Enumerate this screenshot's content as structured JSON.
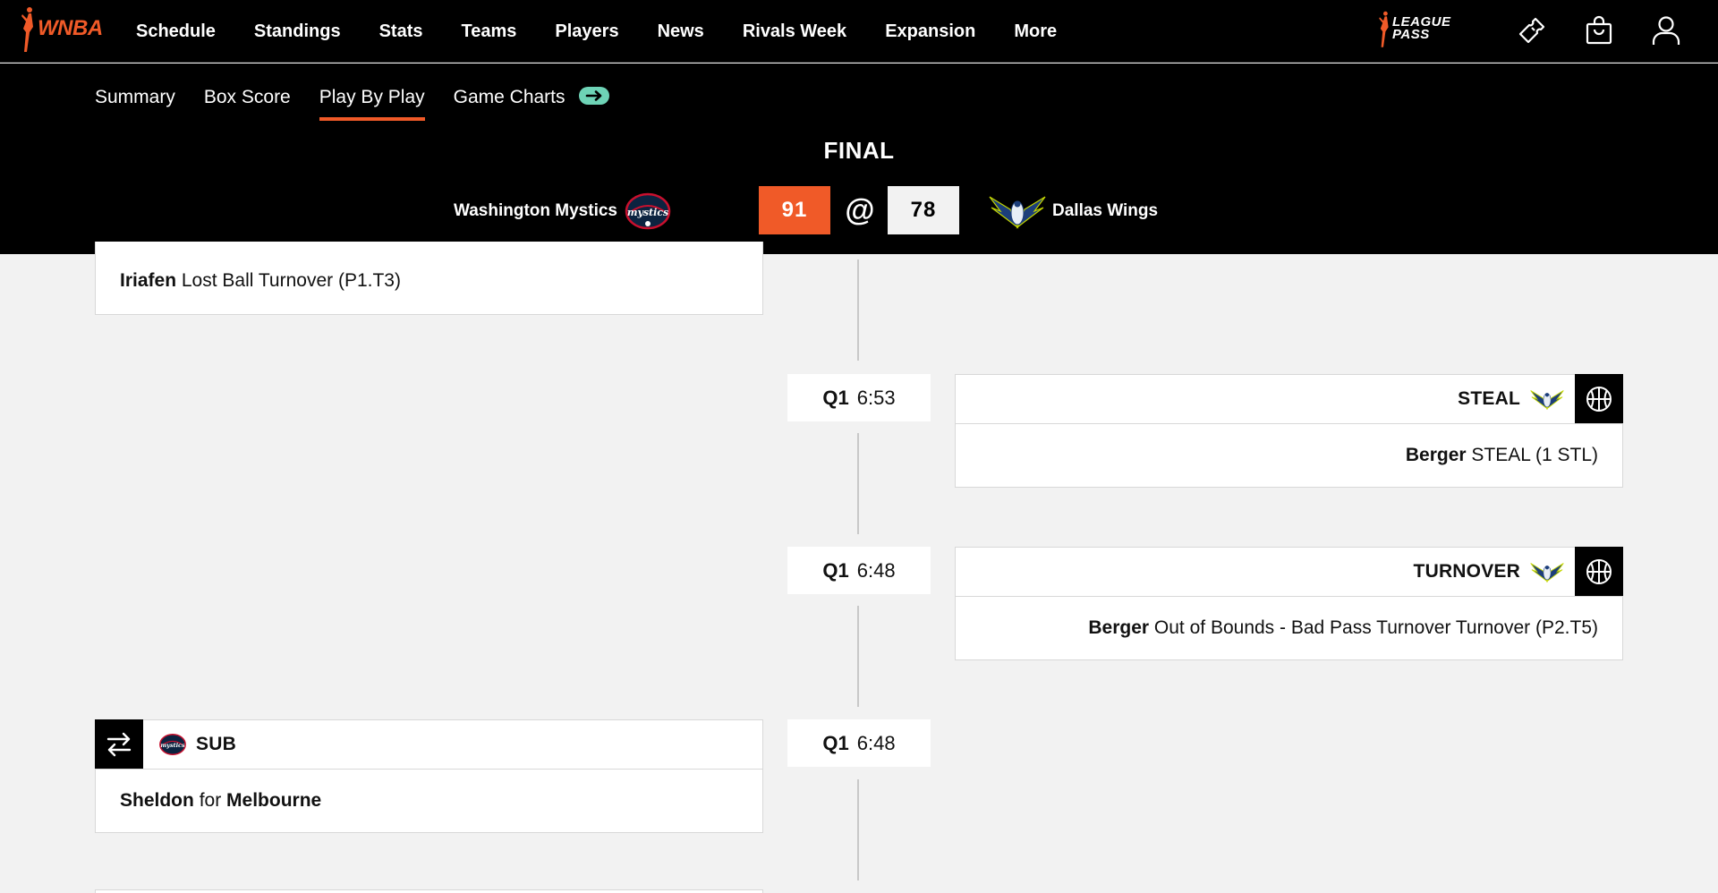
{
  "nav": {
    "logo_text": "WNBA",
    "links": [
      "Schedule",
      "Standings",
      "Stats",
      "Teams",
      "Players",
      "News",
      "Rivals Week",
      "Expansion",
      "More"
    ],
    "league_pass_line1": "LEAGUE",
    "league_pass_line2": "PASS"
  },
  "game_tabs": {
    "items": [
      "Summary",
      "Box Score",
      "Play By Play",
      "Game Charts"
    ],
    "active": "Play By Play"
  },
  "game": {
    "status": "FINAL",
    "away_team": "Washington Mystics",
    "away_score": "91",
    "at": "@",
    "home_team": "Dallas Wings",
    "home_score": "78"
  },
  "plays": [
    {
      "player": "Iriafen",
      "text": "Lost Ball Turnover (P1.T3)"
    },
    {
      "quarter": "Q1",
      "clock": "6:53",
      "type": "STEAL",
      "player": "Berger",
      "text": "STEAL (1 STL)"
    },
    {
      "quarter": "Q1",
      "clock": "6:48",
      "type": "TURNOVER",
      "player": "Berger",
      "text": "Out of Bounds - Bad Pass Turnover Turnover (P2.T5)"
    },
    {
      "quarter": "Q1",
      "clock": "6:48",
      "type": "SUB",
      "player_in": "Sheldon",
      "connector": "for",
      "player_out": "Melbourne"
    }
  ],
  "colors": {
    "accent": "#f05a28",
    "nav_bg": "#000000",
    "page_bg": "#f2f2f2",
    "pill": "#6ed3b6"
  }
}
